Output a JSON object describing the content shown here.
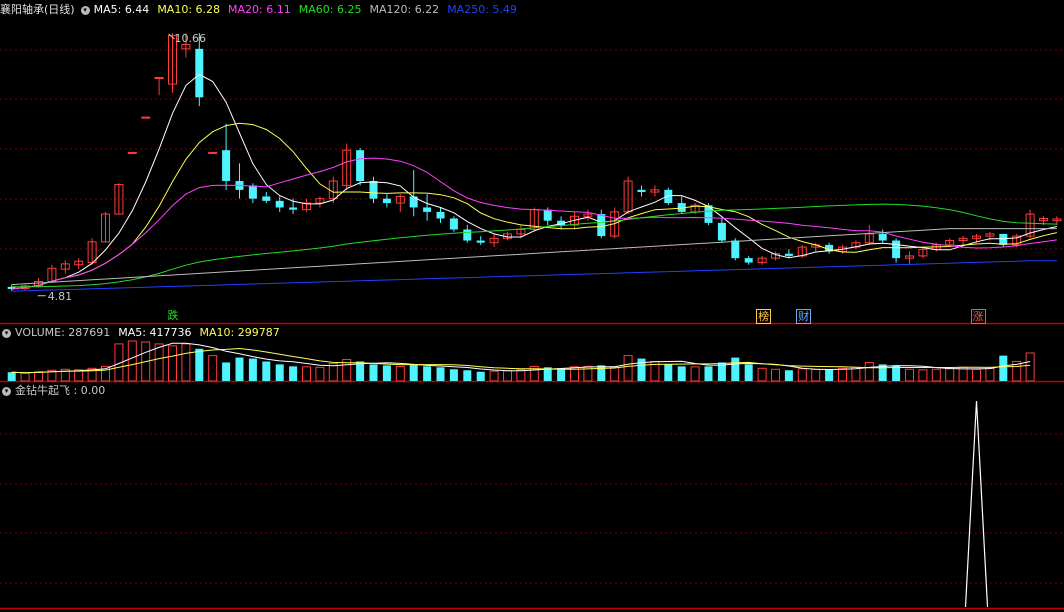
{
  "colors": {
    "bg": "#000000",
    "grid": "#7a0000",
    "border": "#c00000",
    "up": "#ff3c3c",
    "down": "#4df4ff",
    "text": "#c8c8c8",
    "ma5": "#ffffff",
    "ma10": "#ffff50",
    "ma20": "#ff40ff",
    "ma60": "#22dd22",
    "ma120": "#bbbbbb",
    "ma250": "#2040ff"
  },
  "main_panel": {
    "title": "襄阳轴承(日线)",
    "indicators": [
      {
        "label": "MA5: ",
        "value": "6.44",
        "color": "#ffffff"
      },
      {
        "label": "MA10: ",
        "value": "6.28",
        "color": "#ffff50"
      },
      {
        "label": "MA20: ",
        "value": "6.11",
        "color": "#ff40ff"
      },
      {
        "label": "MA60: ",
        "value": "6.25",
        "color": "#22dd22"
      },
      {
        "label": "MA120: ",
        "value": "6.22",
        "color": "#bbbbbb"
      },
      {
        "label": "MA250: ",
        "value": "5.49",
        "color": "#2040ff"
      }
    ],
    "high_label": "10.66",
    "low_label": "4.81",
    "tags": [
      {
        "text": "跌",
        "color": "#22dd22",
        "index": 12
      },
      {
        "text": "榜",
        "color": "#ffcc44",
        "index": 56
      },
      {
        "text": "财",
        "color": "#66aaff",
        "index": 59
      },
      {
        "text": "涨",
        "color": "#ff5050",
        "index": 72
      }
    ]
  },
  "volume_panel": {
    "indicators": [
      {
        "label": "VOLUME: ",
        "value": "287691",
        "color": "#c8c8c8"
      },
      {
        "label": "MA5: ",
        "value": "417736",
        "color": "#ffffff"
      },
      {
        "label": "MA10: ",
        "value": "299787",
        "color": "#ffff50"
      }
    ]
  },
  "signal_panel": {
    "indicators": [
      {
        "label": "金钻牛起飞 : ",
        "value": "0.00",
        "color": "#c8c8c8"
      }
    ]
  },
  "chart_data": {
    "type": "candlestick",
    "price_range": [
      4.6,
      11.0
    ],
    "candles": [
      {
        "o": 4.9,
        "h": 4.95,
        "l": 4.81,
        "c": 4.85
      },
      {
        "o": 4.86,
        "h": 4.95,
        "l": 4.82,
        "c": 4.92
      },
      {
        "o": 4.92,
        "h": 5.1,
        "l": 4.88,
        "c": 5.02
      },
      {
        "o": 5.02,
        "h": 5.4,
        "l": 5.0,
        "c": 5.32
      },
      {
        "o": 5.3,
        "h": 5.5,
        "l": 5.2,
        "c": 5.42
      },
      {
        "o": 5.4,
        "h": 5.55,
        "l": 5.3,
        "c": 5.48
      },
      {
        "o": 5.45,
        "h": 6.0,
        "l": 5.4,
        "c": 5.92
      },
      {
        "o": 5.92,
        "h": 6.6,
        "l": 5.9,
        "c": 6.55
      },
      {
        "o": 6.55,
        "h": 7.25,
        "l": 6.55,
        "c": 7.22
      },
      {
        "o": 7.95,
        "h": 7.95,
        "l": 7.95,
        "c": 7.95
      },
      {
        "o": 8.75,
        "h": 8.75,
        "l": 8.75,
        "c": 8.75
      },
      {
        "o": 9.65,
        "h": 9.65,
        "l": 9.25,
        "c": 9.65
      },
      {
        "o": 9.5,
        "h": 10.66,
        "l": 9.3,
        "c": 10.6
      },
      {
        "o": 10.3,
        "h": 10.66,
        "l": 10.1,
        "c": 10.4
      },
      {
        "o": 10.3,
        "h": 10.66,
        "l": 9.0,
        "c": 9.2
      },
      {
        "o": 7.95,
        "h": 7.95,
        "l": 7.95,
        "c": 7.95
      },
      {
        "o": 8.0,
        "h": 8.6,
        "l": 7.1,
        "c": 7.3
      },
      {
        "o": 7.3,
        "h": 7.7,
        "l": 6.9,
        "c": 7.1
      },
      {
        "o": 7.2,
        "h": 7.25,
        "l": 6.8,
        "c": 6.9
      },
      {
        "o": 6.95,
        "h": 7.05,
        "l": 6.8,
        "c": 6.85
      },
      {
        "o": 6.85,
        "h": 6.95,
        "l": 6.6,
        "c": 6.7
      },
      {
        "o": 6.7,
        "h": 6.9,
        "l": 6.55,
        "c": 6.65
      },
      {
        "o": 6.65,
        "h": 6.9,
        "l": 6.6,
        "c": 6.8
      },
      {
        "o": 6.8,
        "h": 6.95,
        "l": 6.7,
        "c": 6.9
      },
      {
        "o": 6.9,
        "h": 7.4,
        "l": 6.8,
        "c": 7.3
      },
      {
        "o": 7.2,
        "h": 8.15,
        "l": 7.1,
        "c": 8.0
      },
      {
        "o": 8.0,
        "h": 8.05,
        "l": 7.2,
        "c": 7.3
      },
      {
        "o": 7.3,
        "h": 7.4,
        "l": 6.8,
        "c": 6.9
      },
      {
        "o": 6.9,
        "h": 7.0,
        "l": 6.7,
        "c": 6.8
      },
      {
        "o": 6.8,
        "h": 7.0,
        "l": 6.6,
        "c": 6.95
      },
      {
        "o": 6.95,
        "h": 7.55,
        "l": 6.5,
        "c": 6.7
      },
      {
        "o": 6.7,
        "h": 7.0,
        "l": 6.4,
        "c": 6.6
      },
      {
        "o": 6.6,
        "h": 6.7,
        "l": 6.35,
        "c": 6.45
      },
      {
        "o": 6.45,
        "h": 6.5,
        "l": 6.15,
        "c": 6.2
      },
      {
        "o": 6.2,
        "h": 6.3,
        "l": 5.9,
        "c": 5.95
      },
      {
        "o": 5.95,
        "h": 6.05,
        "l": 5.85,
        "c": 5.9
      },
      {
        "o": 5.9,
        "h": 6.1,
        "l": 5.8,
        "c": 6.0
      },
      {
        "o": 6.0,
        "h": 6.15,
        "l": 5.95,
        "c": 6.1
      },
      {
        "o": 6.1,
        "h": 6.3,
        "l": 6.0,
        "c": 6.2
      },
      {
        "o": 6.2,
        "h": 6.7,
        "l": 6.15,
        "c": 6.65
      },
      {
        "o": 6.65,
        "h": 6.7,
        "l": 6.3,
        "c": 6.4
      },
      {
        "o": 6.4,
        "h": 6.5,
        "l": 6.2,
        "c": 6.3
      },
      {
        "o": 6.3,
        "h": 6.6,
        "l": 6.2,
        "c": 6.5
      },
      {
        "o": 6.5,
        "h": 6.65,
        "l": 6.4,
        "c": 6.55
      },
      {
        "o": 6.55,
        "h": 6.65,
        "l": 6.0,
        "c": 6.05
      },
      {
        "o": 6.05,
        "h": 6.7,
        "l": 6.0,
        "c": 6.6
      },
      {
        "o": 6.6,
        "h": 7.4,
        "l": 6.55,
        "c": 7.3
      },
      {
        "o": 7.1,
        "h": 7.2,
        "l": 6.95,
        "c": 7.05
      },
      {
        "o": 7.05,
        "h": 7.2,
        "l": 6.95,
        "c": 7.1
      },
      {
        "o": 7.1,
        "h": 7.15,
        "l": 6.75,
        "c": 6.8
      },
      {
        "o": 6.8,
        "h": 6.95,
        "l": 6.55,
        "c": 6.6
      },
      {
        "o": 6.6,
        "h": 6.8,
        "l": 6.55,
        "c": 6.75
      },
      {
        "o": 6.75,
        "h": 6.8,
        "l": 6.3,
        "c": 6.35
      },
      {
        "o": 6.35,
        "h": 6.45,
        "l": 5.9,
        "c": 5.95
      },
      {
        "o": 5.95,
        "h": 6.0,
        "l": 5.5,
        "c": 5.55
      },
      {
        "o": 5.55,
        "h": 5.6,
        "l": 5.4,
        "c": 5.45
      },
      {
        "o": 5.45,
        "h": 5.6,
        "l": 5.4,
        "c": 5.55
      },
      {
        "o": 5.55,
        "h": 5.7,
        "l": 5.5,
        "c": 5.65
      },
      {
        "o": 5.65,
        "h": 5.75,
        "l": 5.55,
        "c": 5.6
      },
      {
        "o": 5.6,
        "h": 5.85,
        "l": 5.55,
        "c": 5.8
      },
      {
        "o": 5.8,
        "h": 5.9,
        "l": 5.7,
        "c": 5.85
      },
      {
        "o": 5.85,
        "h": 5.9,
        "l": 5.65,
        "c": 5.7
      },
      {
        "o": 5.7,
        "h": 5.85,
        "l": 5.65,
        "c": 5.8
      },
      {
        "o": 5.8,
        "h": 5.95,
        "l": 5.75,
        "c": 5.9
      },
      {
        "o": 5.9,
        "h": 6.3,
        "l": 5.85,
        "c": 6.1
      },
      {
        "o": 6.1,
        "h": 6.2,
        "l": 5.9,
        "c": 5.95
      },
      {
        "o": 5.95,
        "h": 6.0,
        "l": 5.45,
        "c": 5.55
      },
      {
        "o": 5.55,
        "h": 5.7,
        "l": 5.4,
        "c": 5.6
      },
      {
        "o": 5.6,
        "h": 5.8,
        "l": 5.55,
        "c": 5.75
      },
      {
        "o": 5.75,
        "h": 5.9,
        "l": 5.7,
        "c": 5.85
      },
      {
        "o": 5.85,
        "h": 6.0,
        "l": 5.8,
        "c": 5.95
      },
      {
        "o": 5.95,
        "h": 6.05,
        "l": 5.85,
        "c": 6.0
      },
      {
        "o": 6.0,
        "h": 6.1,
        "l": 5.9,
        "c": 6.05
      },
      {
        "o": 6.05,
        "h": 6.15,
        "l": 5.95,
        "c": 6.1
      },
      {
        "o": 6.1,
        "h": 6.1,
        "l": 5.8,
        "c": 5.85
      },
      {
        "o": 5.85,
        "h": 6.1,
        "l": 5.8,
        "c": 6.05
      },
      {
        "o": 6.05,
        "h": 6.65,
        "l": 6.0,
        "c": 6.55
      },
      {
        "o": 6.4,
        "h": 6.5,
        "l": 6.3,
        "c": 6.45
      },
      {
        "o": 6.4,
        "h": 6.5,
        "l": 6.3,
        "c": 6.44
      }
    ],
    "volume": [
      90,
      80,
      95,
      110,
      120,
      115,
      130,
      150,
      380,
      410,
      400,
      380,
      360,
      380,
      330,
      260,
      190,
      240,
      230,
      200,
      170,
      150,
      145,
      140,
      180,
      220,
      200,
      170,
      160,
      150,
      170,
      150,
      140,
      120,
      110,
      95,
      100,
      105,
      115,
      150,
      140,
      130,
      145,
      150,
      160,
      140,
      260,
      230,
      200,
      170,
      150,
      145,
      150,
      190,
      240,
      170,
      130,
      120,
      110,
      125,
      120,
      115,
      130,
      140,
      190,
      170,
      160,
      120,
      115,
      120,
      125,
      140,
      120,
      130,
      260,
      200,
      287
    ],
    "vol_range": [
      0,
      420
    ],
    "ma_periods": {
      "ma5": 5,
      "ma10": 10,
      "ma20": 20,
      "ma60": 60,
      "ma120": 120,
      "ma250": 250
    },
    "signal": {
      "peak_index": 72,
      "value_range": [
        0,
        1
      ]
    }
  }
}
